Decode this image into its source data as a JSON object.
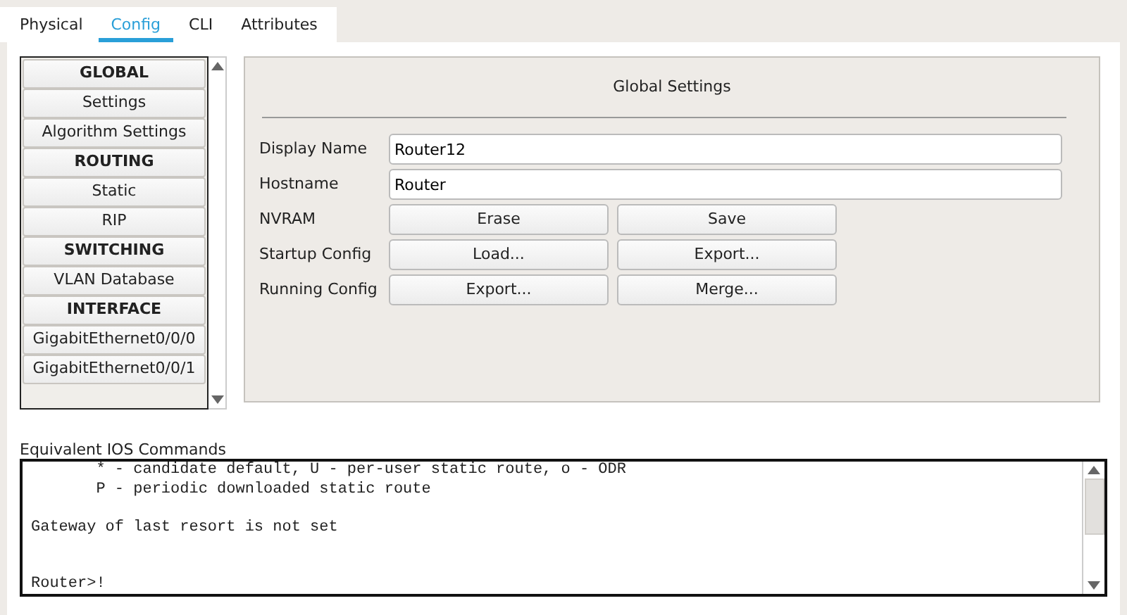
{
  "tabs": [
    {
      "label": "Physical",
      "selected": false
    },
    {
      "label": "Config",
      "selected": true
    },
    {
      "label": "CLI",
      "selected": false
    },
    {
      "label": "Attributes",
      "selected": false
    }
  ],
  "sidebar": {
    "items": [
      {
        "kind": "header",
        "label": "GLOBAL"
      },
      {
        "kind": "item",
        "label": "Settings"
      },
      {
        "kind": "item",
        "label": "Algorithm Settings"
      },
      {
        "kind": "header",
        "label": "ROUTING"
      },
      {
        "kind": "item",
        "label": "Static"
      },
      {
        "kind": "item",
        "label": "RIP"
      },
      {
        "kind": "header",
        "label": "SWITCHING"
      },
      {
        "kind": "item",
        "label": "VLAN Database"
      },
      {
        "kind": "header",
        "label": "INTERFACE"
      },
      {
        "kind": "item",
        "label": "GigabitEthernet0/0/0"
      },
      {
        "kind": "item",
        "label": "GigabitEthernet0/0/1"
      }
    ]
  },
  "panel": {
    "title": "Global Settings",
    "rows": [
      {
        "kind": "field",
        "label": "Display Name",
        "value": "Router12"
      },
      {
        "kind": "field",
        "label": "Hostname",
        "value": "Router"
      },
      {
        "kind": "buttons",
        "label": "NVRAM",
        "buttons": [
          "Erase",
          "Save"
        ]
      },
      {
        "kind": "buttons",
        "label": "Startup Config",
        "buttons": [
          "Load...",
          "Export..."
        ]
      },
      {
        "kind": "buttons",
        "label": "Running Config",
        "buttons": [
          "Export...",
          "Merge..."
        ]
      }
    ]
  },
  "ios_commands": {
    "label": "Equivalent IOS Commands",
    "text": "       * - candidate default, U - per-user static route, o - ODR\n       P - periodic downloaded static route\n\nGateway of last resort is not set\n\n\nRouter>!"
  }
}
